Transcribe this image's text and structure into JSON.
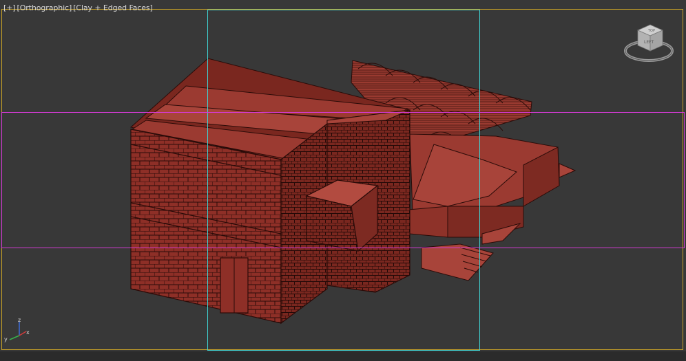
{
  "viewport": {
    "label_plus": "[+]",
    "label_view": "[Orthographic]",
    "label_shading": "[Clay + Edged Faces]",
    "colors": {
      "background": "#383838",
      "frame": "#c9a227",
      "safe_frame_action": "#3fd2d2",
      "safe_frame_title": "#d63ad6",
      "clay_face": "#8a2f27",
      "clay_edge": "#2a0b08"
    }
  },
  "viewcube": {
    "icon": "viewcube-icon",
    "face_label": "LEFT",
    "top_label": "TOP"
  },
  "axis": {
    "z": "z",
    "y": "y",
    "x": "x"
  }
}
